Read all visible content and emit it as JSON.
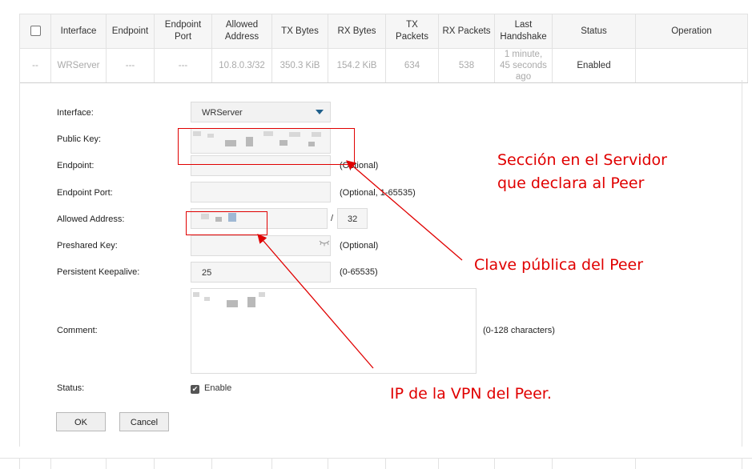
{
  "table": {
    "headers": [
      "",
      "Interface",
      "Endpoint",
      "Endpoint Port",
      "Allowed Address",
      "TX Bytes",
      "RX Bytes",
      "TX Packets",
      "RX Packets",
      "Last Handshake",
      "Status",
      "Operation"
    ],
    "row": {
      "id": "--",
      "interface": "WRServer",
      "endpoint": "---",
      "endpoint_port": "---",
      "allowed_address": "10.8.0.3/32",
      "tx_bytes": "350.3 KiB",
      "rx_bytes": "154.2 KiB",
      "tx_packets": "634",
      "rx_packets": "538",
      "last_handshake": "1 minute, 45 seconds ago",
      "status": "Enabled",
      "operation": ""
    }
  },
  "form": {
    "interface": {
      "label": "Interface:",
      "value": "WRServer"
    },
    "public_key": {
      "label": "Public Key:"
    },
    "endpoint": {
      "label": "Endpoint:",
      "hint": "(Optional)"
    },
    "endpoint_port": {
      "label": "Endpoint Port:",
      "hint": "(Optional, 1-65535)"
    },
    "allowed_address": {
      "label": "Allowed Address:",
      "separator": "/",
      "mask": "32"
    },
    "preshared_key": {
      "label": "Preshared Key:",
      "hint": "(Optional)"
    },
    "keepalive": {
      "label": "Persistent Keepalive:",
      "value": "25",
      "hint": "(0-65535)"
    },
    "comment": {
      "label": "Comment:",
      "hint": "(0-128 characters)"
    },
    "status": {
      "label": "Status:",
      "checkbox_label": "Enable",
      "checked": true
    },
    "buttons": {
      "ok": "OK",
      "cancel": "Cancel"
    }
  },
  "annotations": {
    "section_line1": "Sección en el Servidor",
    "section_line2": "que declara al Peer",
    "public_key_note": "Clave pública del Peer",
    "ip_note": "IP de la VPN del Peer.",
    "color": "#e00000"
  },
  "icons": {
    "caret": "dropdown-caret-icon",
    "eye": "eye-closed-icon",
    "check": "checkmark-icon"
  }
}
